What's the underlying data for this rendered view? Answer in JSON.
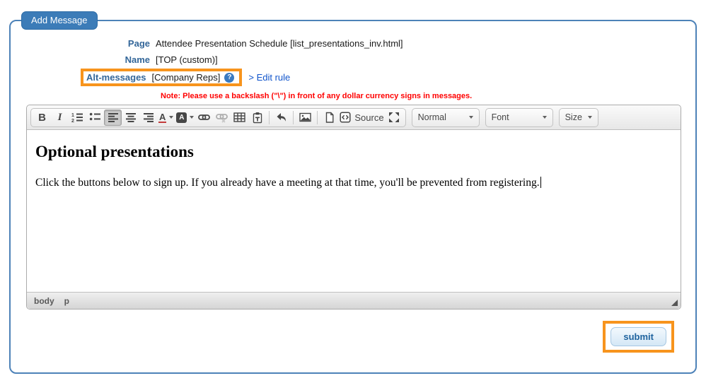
{
  "tab": {
    "label": "Add Message"
  },
  "form": {
    "rows": [
      {
        "label": "Page",
        "value": "Attendee Presentation Schedule [list_presentations_inv.html]"
      },
      {
        "label": "Name",
        "value": "[TOP (custom)]"
      },
      {
        "label": "Alt-messages",
        "value": "[Company Reps]",
        "help_glyph": "?",
        "link_prefix": ">",
        "link": "Edit rule",
        "highlighted": true
      }
    ],
    "note": "Note: Please use a backslash (\"\\\") in front of any dollar currency signs in messages."
  },
  "editor": {
    "toolbar": {
      "bold_glyph": "B",
      "italic_glyph": "I",
      "text_color_glyph": "A",
      "bg_color_glyph": "A",
      "source_label": "Source",
      "active_button": "align-left",
      "icons": [
        "bold",
        "italic",
        "numbered-list",
        "bulleted-list",
        "align-left",
        "align-center",
        "align-right",
        "text-color",
        "background-color",
        "link",
        "unlink",
        "table",
        "paste-text",
        "undo",
        "image",
        "new-page",
        "source",
        "maximize"
      ],
      "dropdowns": [
        {
          "label": "Normal"
        },
        {
          "label": "Font"
        },
        {
          "label": "Size"
        }
      ]
    },
    "content": {
      "heading": "Optional presentations",
      "paragraph": "Click the buttons below to sign up. If you already have a meeting at that time, you'll be prevented from registering."
    },
    "status_bar": {
      "path": [
        "body",
        "p"
      ]
    }
  },
  "submit": {
    "label": "submit",
    "highlighted": true
  },
  "colors": {
    "highlight_orange": "#F7941D",
    "tab_blue": "#3C7CB8",
    "label_blue": "#336699",
    "link_blue": "#1155CC",
    "note_red": "#FF0000",
    "submit_text_blue": "#1F639E",
    "panel_border_blue": "#4D82B8"
  }
}
